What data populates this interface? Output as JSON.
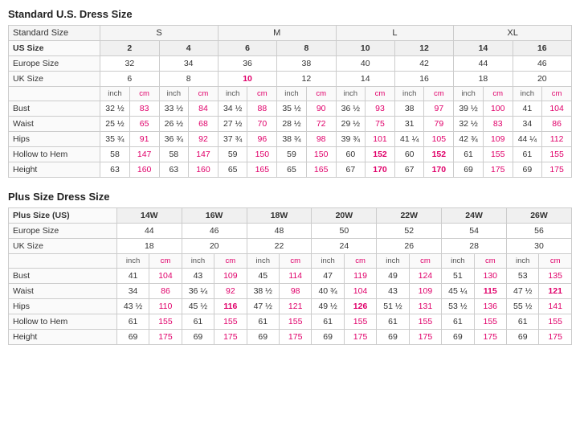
{
  "standard": {
    "title": "Standard U.S. Dress Size",
    "size_groups": [
      "S",
      "M",
      "L",
      "XL"
    ],
    "headers": {
      "standard_size": "Standard Size",
      "us_size": "US Size",
      "europe_size": "Europe Size",
      "uk_size": "UK Size"
    },
    "us_sizes": [
      "2",
      "4",
      "6",
      "8",
      "10",
      "12",
      "14",
      "16"
    ],
    "europe_sizes": [
      "32",
      "34",
      "36",
      "38",
      "40",
      "42",
      "44",
      "46"
    ],
    "uk_sizes": [
      "6",
      "8",
      "10",
      "12",
      "14",
      "16",
      "18",
      "20"
    ],
    "uk_highlights": [
      2,
      3
    ],
    "measurements": [
      {
        "label": "Bust",
        "values": [
          "32 ½",
          "83",
          "33 ½",
          "84",
          "34 ½",
          "88",
          "35 ½",
          "90",
          "36 ½",
          "93",
          "38",
          "97",
          "39 ½",
          "100",
          "41",
          "104"
        ]
      },
      {
        "label": "Waist",
        "values": [
          "25 ½",
          "65",
          "26 ½",
          "68",
          "27 ½",
          "70",
          "28 ½",
          "72",
          "29 ½",
          "75",
          "31",
          "79",
          "32 ½",
          "83",
          "34",
          "86"
        ]
      },
      {
        "label": "Hips",
        "values": [
          "35 ¾",
          "91",
          "36 ¾",
          "92",
          "37 ¾",
          "96",
          "38 ¾",
          "98",
          "39 ¾",
          "101",
          "41 ¼",
          "105",
          "42 ¾",
          "109",
          "44 ¼",
          "112"
        ]
      },
      {
        "label": "Hollow to Hem",
        "values": [
          "58",
          "147",
          "58",
          "147",
          "59",
          "150",
          "59",
          "150",
          "60",
          "152",
          "60",
          "152",
          "61",
          "155",
          "61",
          "155"
        ],
        "highlights": [
          9,
          11
        ]
      },
      {
        "label": "Height",
        "values": [
          "63",
          "160",
          "63",
          "160",
          "65",
          "165",
          "65",
          "165",
          "67",
          "170",
          "67",
          "170",
          "69",
          "175",
          "69",
          "175"
        ],
        "highlights": [
          9,
          11
        ]
      }
    ]
  },
  "plus": {
    "title": "Plus Size Dress Size",
    "size_labels": [
      "Plus Size (US)",
      "14W",
      "16W",
      "18W",
      "20W",
      "22W",
      "24W",
      "26W"
    ],
    "europe_sizes": [
      "44",
      "46",
      "48",
      "50",
      "52",
      "54",
      "56"
    ],
    "uk_sizes": [
      "18",
      "20",
      "22",
      "24",
      "26",
      "28",
      "30"
    ],
    "measurements": [
      {
        "label": "Bust",
        "values": [
          "41",
          "104",
          "43",
          "109",
          "45",
          "114",
          "47",
          "119",
          "49",
          "124",
          "51",
          "130",
          "53",
          "135"
        ]
      },
      {
        "label": "Waist",
        "values": [
          "34",
          "86",
          "36 ¼",
          "92",
          "38 ½",
          "98",
          "40 ¾",
          "104",
          "43",
          "109",
          "45 ¼",
          "115",
          "47 ½",
          "121"
        ],
        "highlights": [
          11,
          13
        ]
      },
      {
        "label": "Hips",
        "values": [
          "43 ½",
          "110",
          "45 ½",
          "116",
          "47 ½",
          "121",
          "49 ½",
          "126",
          "51 ½",
          "131",
          "53 ½",
          "136",
          "55 ½",
          "141"
        ],
        "highlights": [
          3,
          7
        ]
      },
      {
        "label": "Hollow to Hem",
        "values": [
          "61",
          "155",
          "61",
          "155",
          "61",
          "155",
          "61",
          "155",
          "61",
          "155",
          "61",
          "155",
          "61",
          "155"
        ]
      },
      {
        "label": "Height",
        "values": [
          "69",
          "175",
          "69",
          "175",
          "69",
          "175",
          "69",
          "175",
          "69",
          "175",
          "69",
          "175",
          "69",
          "175"
        ]
      }
    ]
  }
}
